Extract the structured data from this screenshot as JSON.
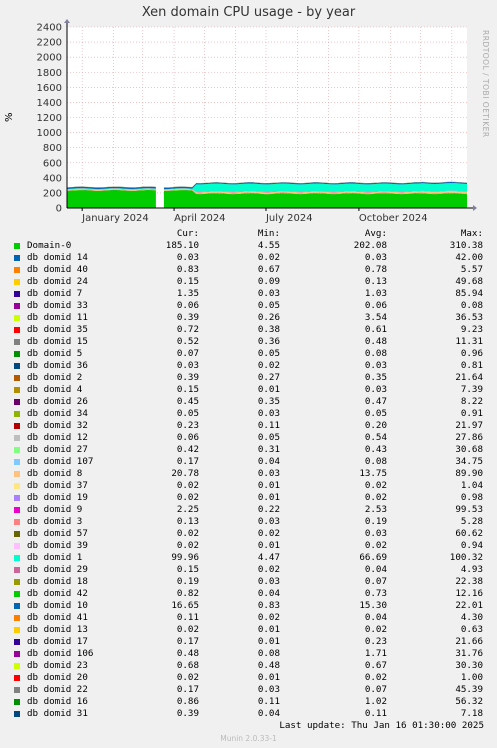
{
  "chart_data": {
    "type": "area",
    "title": "Xen domain CPU usage - by year",
    "ylabel": "%",
    "ylim": [
      0,
      2400
    ],
    "yticks": [
      0,
      200,
      400,
      600,
      800,
      1000,
      1200,
      1400,
      1600,
      1800,
      2000,
      2200,
      2400
    ],
    "xlim": [
      "2023-12-17",
      "2025-01-16"
    ],
    "xticks": [
      {
        "label": "January 2024",
        "date": "2024-01-01"
      },
      {
        "label": "April 2024",
        "date": "2024-04-01"
      },
      {
        "label": "July 2024",
        "date": "2024-07-01"
      },
      {
        "label": "October 2024",
        "date": "2024-10-01"
      }
    ],
    "grid": true,
    "gaps": [
      [
        "2024-03-14",
        "2024-03-22"
      ]
    ],
    "columns": [
      "Cur:",
      "Min:",
      "Avg:",
      "Max:"
    ],
    "series": [
      {
        "name": "Domain-0",
        "color": "#00cc00",
        "cur": "185.10",
        "min": "4.55",
        "avg": "202.08",
        "max": "310.38"
      },
      {
        "name": "db domid 14",
        "color": "#0066b3",
        "cur": "0.03",
        "min": "0.02",
        "avg": "0.03",
        "max": "42.00"
      },
      {
        "name": "db domid 40",
        "color": "#ff8000",
        "cur": "0.83",
        "min": "0.67",
        "avg": "0.78",
        "max": "5.57"
      },
      {
        "name": "db domid 24",
        "color": "#ffcc00",
        "cur": "0.15",
        "min": "0.09",
        "avg": "0.13",
        "max": "49.68"
      },
      {
        "name": "db domid 7",
        "color": "#330099",
        "cur": "1.35",
        "min": "0.03",
        "avg": "1.03",
        "max": "85.94"
      },
      {
        "name": "db domid 33",
        "color": "#990099",
        "cur": "0.06",
        "min": "0.05",
        "avg": "0.06",
        "max": "0.08"
      },
      {
        "name": "db domid 11",
        "color": "#ccff00",
        "cur": "0.39",
        "min": "0.26",
        "avg": "3.54",
        "max": "36.53"
      },
      {
        "name": "db domid 35",
        "color": "#ff0000",
        "cur": "0.72",
        "min": "0.38",
        "avg": "0.61",
        "max": "9.23"
      },
      {
        "name": "db domid 15",
        "color": "#808080",
        "cur": "0.52",
        "min": "0.36",
        "avg": "0.48",
        "max": "11.31"
      },
      {
        "name": "db domid 5",
        "color": "#008f00",
        "cur": "0.07",
        "min": "0.05",
        "avg": "0.08",
        "max": "0.96"
      },
      {
        "name": "db domid 36",
        "color": "#00487d",
        "cur": "0.03",
        "min": "0.02",
        "avg": "0.03",
        "max": "0.81"
      },
      {
        "name": "db domid 2",
        "color": "#b35a00",
        "cur": "0.39",
        "min": "0.27",
        "avg": "0.35",
        "max": "21.64"
      },
      {
        "name": "db domid 4",
        "color": "#b38f00",
        "cur": "0.15",
        "min": "0.01",
        "avg": "0.03",
        "max": "7.39"
      },
      {
        "name": "db domid 26",
        "color": "#6b006b",
        "cur": "0.45",
        "min": "0.35",
        "avg": "0.47",
        "max": "8.22"
      },
      {
        "name": "db domid 34",
        "color": "#8fb300",
        "cur": "0.05",
        "min": "0.03",
        "avg": "0.05",
        "max": "0.91"
      },
      {
        "name": "db domid 32",
        "color": "#b30000",
        "cur": "0.23",
        "min": "0.11",
        "avg": "0.20",
        "max": "21.97"
      },
      {
        "name": "db domid 12",
        "color": "#bebebe",
        "cur": "0.06",
        "min": "0.05",
        "avg": "0.54",
        "max": "27.86"
      },
      {
        "name": "db domid 27",
        "color": "#80ff80",
        "cur": "0.42",
        "min": "0.31",
        "avg": "0.43",
        "max": "30.68"
      },
      {
        "name": "db domid 107",
        "color": "#80c9ff",
        "cur": "0.17",
        "min": "0.04",
        "avg": "0.08",
        "max": "34.75"
      },
      {
        "name": "db domid 8",
        "color": "#ffc080",
        "cur": "20.78",
        "min": "0.03",
        "avg": "13.75",
        "max": "89.90"
      },
      {
        "name": "db domid 37",
        "color": "#ffe680",
        "cur": "0.02",
        "min": "0.01",
        "avg": "0.02",
        "max": "1.04"
      },
      {
        "name": "db domid 19",
        "color": "#aa80ff",
        "cur": "0.02",
        "min": "0.01",
        "avg": "0.02",
        "max": "0.98"
      },
      {
        "name": "db domid 9",
        "color": "#ee00cc",
        "cur": "2.25",
        "min": "0.22",
        "avg": "2.53",
        "max": "99.53"
      },
      {
        "name": "db domid 3",
        "color": "#ff8080",
        "cur": "0.13",
        "min": "0.03",
        "avg": "0.19",
        "max": "5.28"
      },
      {
        "name": "db domid 57",
        "color": "#666600",
        "cur": "0.02",
        "min": "0.02",
        "avg": "0.03",
        "max": "60.62"
      },
      {
        "name": "db domid 39",
        "color": "#ffbfff",
        "cur": "0.02",
        "min": "0.01",
        "avg": "0.02",
        "max": "0.94"
      },
      {
        "name": "db domid 1",
        "color": "#00ffcc",
        "cur": "99.96",
        "min": "4.47",
        "avg": "66.69",
        "max": "100.32"
      },
      {
        "name": "db domid 29",
        "color": "#cc6699",
        "cur": "0.15",
        "min": "0.02",
        "avg": "0.04",
        "max": "4.93"
      },
      {
        "name": "db domid 18",
        "color": "#999900",
        "cur": "0.19",
        "min": "0.03",
        "avg": "0.07",
        "max": "22.38"
      },
      {
        "name": "db domid 42",
        "color": "#00cc00",
        "cur": "0.82",
        "min": "0.04",
        "avg": "0.73",
        "max": "12.16"
      },
      {
        "name": "db domid 10",
        "color": "#0066b3",
        "cur": "16.65",
        "min": "0.83",
        "avg": "15.30",
        "max": "22.01"
      },
      {
        "name": "db domid 41",
        "color": "#ff8000",
        "cur": "0.11",
        "min": "0.02",
        "avg": "0.04",
        "max": "4.30"
      },
      {
        "name": "db domid 13",
        "color": "#ffcc00",
        "cur": "0.02",
        "min": "0.01",
        "avg": "0.02",
        "max": "0.63"
      },
      {
        "name": "db domid 17",
        "color": "#330099",
        "cur": "0.17",
        "min": "0.01",
        "avg": "0.23",
        "max": "21.66"
      },
      {
        "name": "db domid 106",
        "color": "#990099",
        "cur": "0.48",
        "min": "0.08",
        "avg": "1.71",
        "max": "31.76"
      },
      {
        "name": "db domid 23",
        "color": "#ccff00",
        "cur": "0.68",
        "min": "0.48",
        "avg": "0.67",
        "max": "30.30"
      },
      {
        "name": "db domid 20",
        "color": "#ff0000",
        "cur": "0.02",
        "min": "0.01",
        "avg": "0.02",
        "max": "1.00"
      },
      {
        "name": "db domid 22",
        "color": "#808080",
        "cur": "0.17",
        "min": "0.03",
        "avg": "0.07",
        "max": "45.39"
      },
      {
        "name": "db domid 16",
        "color": "#008f00",
        "cur": "0.86",
        "min": "0.11",
        "avg": "1.02",
        "max": "56.32"
      },
      {
        "name": "db domid 31",
        "color": "#00487d",
        "cur": "0.39",
        "min": "0.04",
        "avg": "0.11",
        "max": "7.18"
      }
    ]
  },
  "side_text": "RRDTOOL / TOBI OETIKER",
  "footer": {
    "last_update": "Last update:  Thu Jan 16 01:30:00 2025",
    "munin": "Munin 2.0.33-1"
  }
}
